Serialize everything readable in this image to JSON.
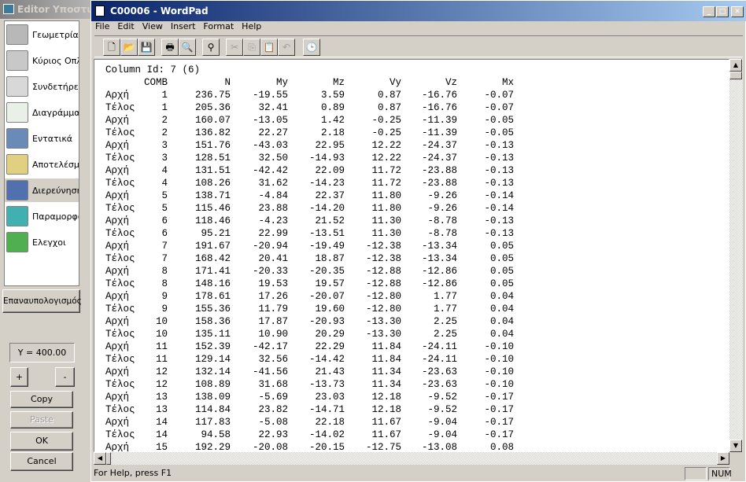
{
  "editor": {
    "title": "Editor Υποστυλ",
    "nav": [
      {
        "label": "Γεωμετρία",
        "icon": "geometry-icon",
        "color": "#b8b8b8"
      },
      {
        "label": "Κύριος Οπλισ",
        "icon": "main-reinforcement-icon",
        "color": "#c8c8c8"
      },
      {
        "label": "Συνδετήρες",
        "icon": "stirrups-icon",
        "color": "#d8d8d8"
      },
      {
        "label": "Διαγράμματα",
        "icon": "diagrams-icon",
        "color": "#e8f0e8"
      },
      {
        "label": "Εντατικά",
        "icon": "sigma-icon",
        "color": "#6a8ab8"
      },
      {
        "label": "Αποτελέσματ",
        "icon": "results-pencil-icon",
        "color": "#e0d080"
      },
      {
        "label": "Διερεύνηση",
        "icon": "investigation-icon",
        "color": "#5070b0",
        "selected": true
      },
      {
        "label": "Παραμορφώσ",
        "icon": "deformation-icon",
        "color": "#40b0b0"
      },
      {
        "label": "Ελεγχοι",
        "icon": "checks-icon",
        "color": "#50b050"
      }
    ],
    "recalc": "Επαναυπολογισμός",
    "y_value": "Y = 400.00",
    "plus": "+",
    "minus": "-",
    "copy": "Copy",
    "paste": "Paste",
    "ok": "OK",
    "cancel": "Cancel"
  },
  "wordpad": {
    "title": "C00006 - WordPad",
    "menu": [
      "File",
      "Edit",
      "View",
      "Insert",
      "Format",
      "Help"
    ],
    "toolbar": [
      {
        "icon": "new-icon",
        "g": "🗋"
      },
      {
        "icon": "open-icon",
        "g": "📂"
      },
      {
        "icon": "save-icon",
        "g": "💾"
      },
      {
        "icon": "print-icon",
        "g": "🖶"
      },
      {
        "icon": "print-preview-icon",
        "g": "🔍"
      },
      {
        "icon": "find-icon",
        "g": "⚲"
      },
      {
        "icon": "cut-icon",
        "g": "✂",
        "dis": true
      },
      {
        "icon": "copy-icon",
        "g": "⎘",
        "dis": true
      },
      {
        "icon": "paste-icon",
        "g": "📋"
      },
      {
        "icon": "undo-icon",
        "g": "↶",
        "dis": true
      },
      {
        "icon": "date-time-icon",
        "g": "🕒"
      }
    ],
    "status": "For Help, press F1",
    "num": "NUM"
  },
  "document": {
    "heading": "Column Id: 7 (6)",
    "columns": [
      "",
      "COMB",
      "N",
      "My",
      "Mz",
      "Vy",
      "Vz",
      "Mx"
    ],
    "rows": [
      [
        "Αρχή",
        "1",
        "236.75",
        "-19.55",
        "3.59",
        "0.87",
        "-16.76",
        "-0.07"
      ],
      [
        "Τέλος",
        "1",
        "205.36",
        "32.41",
        "0.89",
        "0.87",
        "-16.76",
        "-0.07"
      ],
      [
        "Αρχή",
        "2",
        "160.07",
        "-13.05",
        "1.42",
        "-0.25",
        "-11.39",
        "-0.05"
      ],
      [
        "Τέλος",
        "2",
        "136.82",
        "22.27",
        "2.18",
        "-0.25",
        "-11.39",
        "-0.05"
      ],
      [
        "Αρχή",
        "3",
        "151.76",
        "-43.03",
        "22.95",
        "12.22",
        "-24.37",
        "-0.13"
      ],
      [
        "Τέλος",
        "3",
        "128.51",
        "32.50",
        "-14.93",
        "12.22",
        "-24.37",
        "-0.13"
      ],
      [
        "Αρχή",
        "4",
        "131.51",
        "-42.42",
        "22.09",
        "11.72",
        "-23.88",
        "-0.13"
      ],
      [
        "Τέλος",
        "4",
        "108.26",
        "31.62",
        "-14.23",
        "11.72",
        "-23.88",
        "-0.13"
      ],
      [
        "Αρχή",
        "5",
        "138.71",
        "-4.84",
        "22.37",
        "11.80",
        "-9.26",
        "-0.14"
      ],
      [
        "Τέλος",
        "5",
        "115.46",
        "23.88",
        "-14.20",
        "11.80",
        "-9.26",
        "-0.14"
      ],
      [
        "Αρχή",
        "6",
        "118.46",
        "-4.23",
        "21.52",
        "11.30",
        "-8.78",
        "-0.13"
      ],
      [
        "Τέλος",
        "6",
        "95.21",
        "22.99",
        "-13.51",
        "11.30",
        "-8.78",
        "-0.13"
      ],
      [
        "Αρχή",
        "7",
        "191.67",
        "-20.94",
        "-19.49",
        "-12.38",
        "-13.34",
        "0.05"
      ],
      [
        "Τέλος",
        "7",
        "168.42",
        "20.41",
        "18.87",
        "-12.38",
        "-13.34",
        "0.05"
      ],
      [
        "Αρχή",
        "8",
        "171.41",
        "-20.33",
        "-20.35",
        "-12.88",
        "-12.86",
        "0.05"
      ],
      [
        "Τέλος",
        "8",
        "148.16",
        "19.53",
        "19.57",
        "-12.88",
        "-12.86",
        "0.05"
      ],
      [
        "Αρχή",
        "9",
        "178.61",
        "17.26",
        "-20.07",
        "-12.80",
        "1.77",
        "0.04"
      ],
      [
        "Τέλος",
        "9",
        "155.36",
        "11.79",
        "19.60",
        "-12.80",
        "1.77",
        "0.04"
      ],
      [
        "Αρχή",
        "10",
        "158.36",
        "17.87",
        "-20.93",
        "-13.30",
        "2.25",
        "0.04"
      ],
      [
        "Τέλος",
        "10",
        "135.11",
        "10.90",
        "20.29",
        "-13.30",
        "2.25",
        "0.04"
      ],
      [
        "Αρχή",
        "11",
        "152.39",
        "-42.17",
        "22.29",
        "11.84",
        "-24.11",
        "-0.10"
      ],
      [
        "Τέλος",
        "11",
        "129.14",
        "32.56",
        "-14.42",
        "11.84",
        "-24.11",
        "-0.10"
      ],
      [
        "Αρχή",
        "12",
        "132.14",
        "-41.56",
        "21.43",
        "11.34",
        "-23.63",
        "-0.10"
      ],
      [
        "Τέλος",
        "12",
        "108.89",
        "31.68",
        "-13.73",
        "11.34",
        "-23.63",
        "-0.10"
      ],
      [
        "Αρχή",
        "13",
        "138.09",
        "-5.69",
        "23.03",
        "12.18",
        "-9.52",
        "-0.17"
      ],
      [
        "Τέλος",
        "13",
        "114.84",
        "23.82",
        "-14.71",
        "12.18",
        "-9.52",
        "-0.17"
      ],
      [
        "Αρχή",
        "14",
        "117.83",
        "-5.08",
        "22.18",
        "11.67",
        "-9.04",
        "-0.17"
      ],
      [
        "Τέλος",
        "14",
        "94.58",
        "22.93",
        "-14.02",
        "11.67",
        "-9.04",
        "-0.17"
      ],
      [
        "Αρχή",
        "15",
        "192.29",
        "-20.08",
        "-20.15",
        "-12.75",
        "-13.08",
        "0.08"
      ]
    ]
  }
}
